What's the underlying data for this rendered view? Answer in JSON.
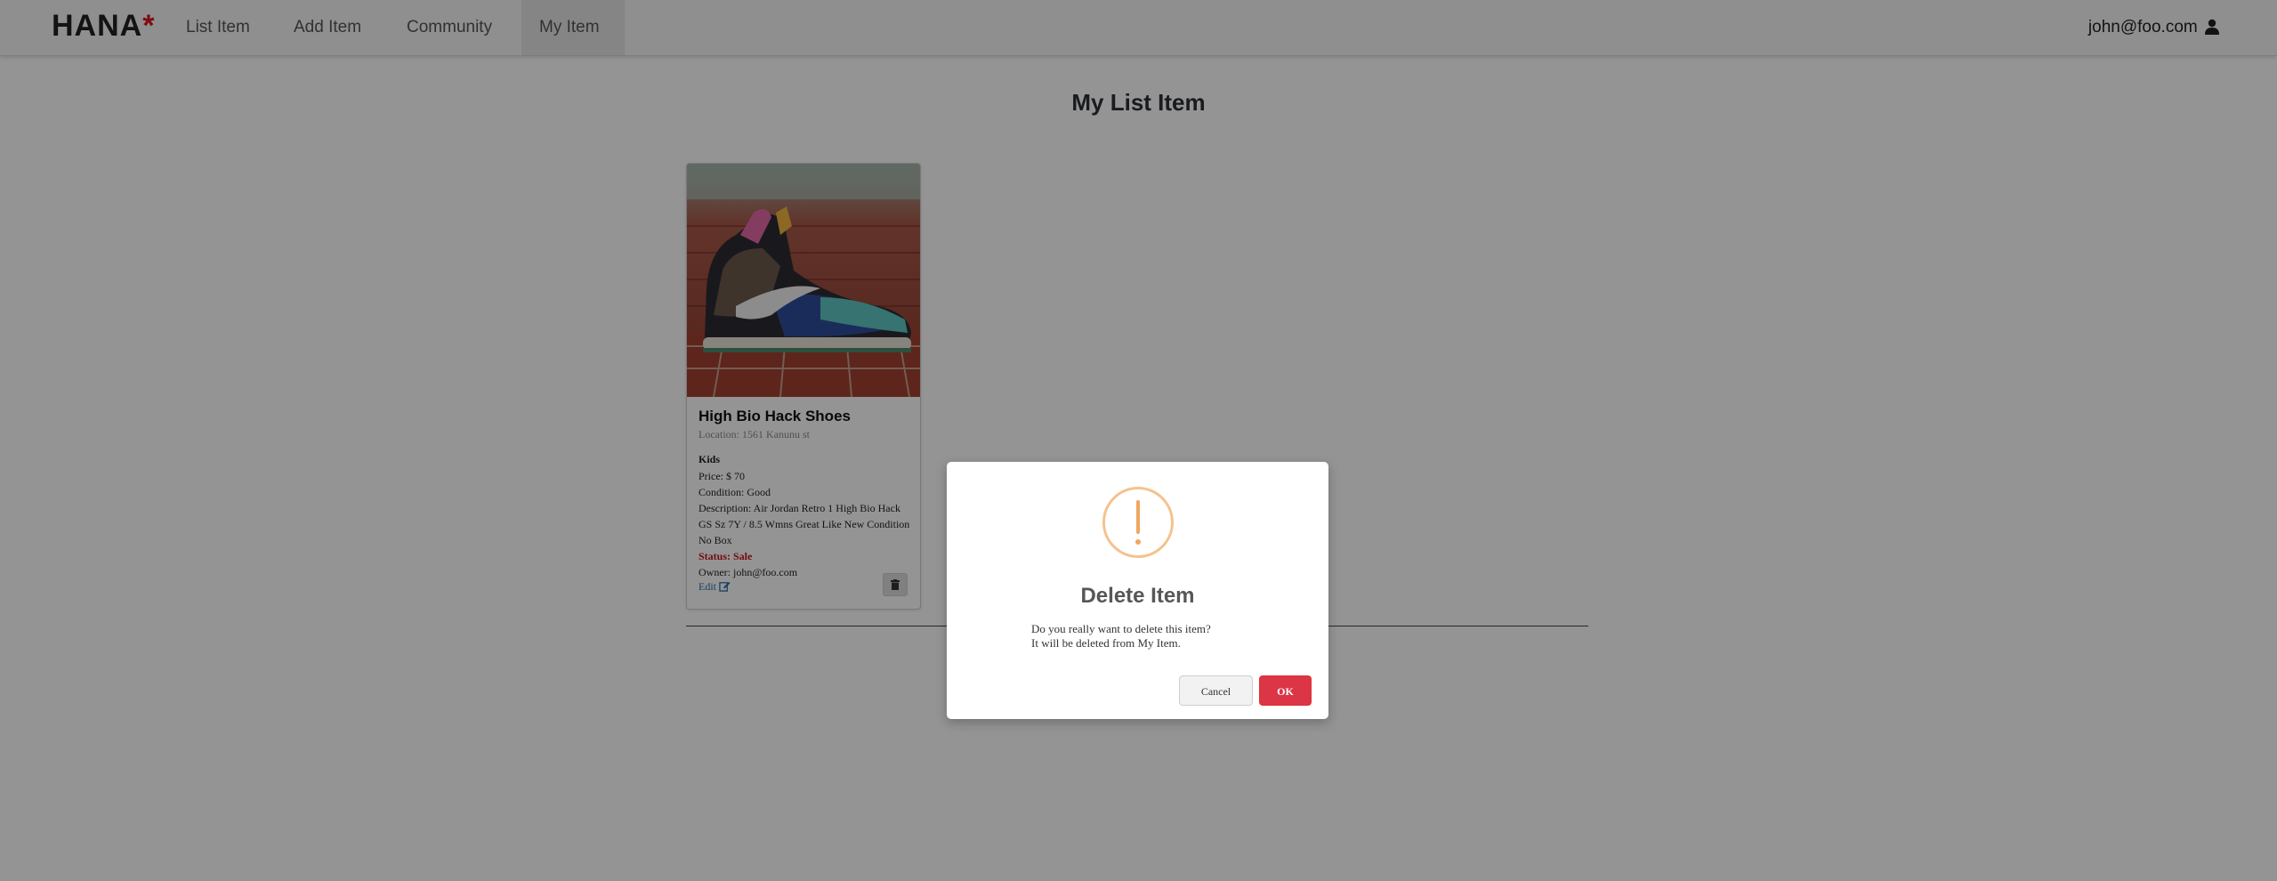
{
  "navbar": {
    "brand_text": "HANA",
    "brand_star": "*",
    "items": [
      {
        "label": "List Item"
      },
      {
        "label": "Add Item"
      },
      {
        "label": "Community"
      },
      {
        "label": "My Item"
      }
    ],
    "active_item": "My Item",
    "user_email": "john@foo.com",
    "user_icon": "user-icon"
  },
  "page": {
    "title": "My List Item"
  },
  "item_card": {
    "image_desc": "sneaker-photo",
    "title": "High Bio Hack Shoes",
    "location": "Location: 1561 Kanunu st",
    "category": "Kids",
    "price": "Price: $ 70",
    "condition": "Condition: Good",
    "description": "Description: Air Jordan Retro 1 High Bio Hack GS Sz 7Y / 8.5 Wmns Great Like New Condition No Box",
    "status": "Status: Sale",
    "owner": "Owner: john@foo.com",
    "edit_label": "Edit",
    "edit_icon": "edit-icon",
    "delete_icon": "trash-icon"
  },
  "modal": {
    "icon": "warning-icon",
    "title": "Delete Item",
    "message_line1": "Do you really want to delete this item?",
    "message_line2": "It will be deleted from My Item.",
    "cancel_label": "Cancel",
    "ok_label": "OK"
  },
  "colors": {
    "brand_star": "#d9141f",
    "status_sale": "#c4161c",
    "ok_button": "#dc3545",
    "warning": "#f0a75f",
    "link": "#2a6db0"
  }
}
